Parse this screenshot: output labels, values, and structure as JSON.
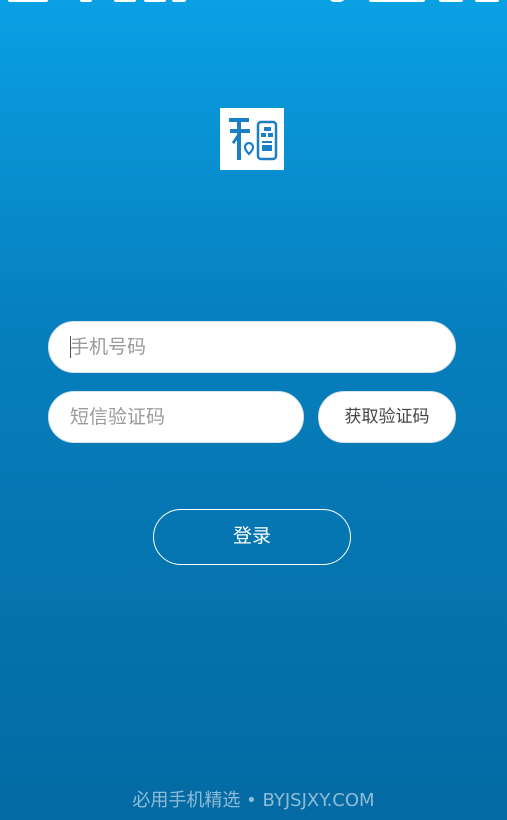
{
  "login": {
    "phone_placeholder": "手机号码",
    "phone_value": "",
    "sms_code_placeholder": "短信验证码",
    "sms_code_value": "",
    "get_code_label": "获取验证码",
    "login_label": "登录"
  },
  "footer": {
    "watermark": "必用手机精选 • BYJSJXY.COM"
  },
  "colors": {
    "background_top": "#0aa0e4",
    "background_bottom": "#046aa3",
    "logo_blue": "#1a7fc4",
    "input_bg": "#ffffff"
  },
  "icons": {
    "logo": "app-logo-icon"
  }
}
